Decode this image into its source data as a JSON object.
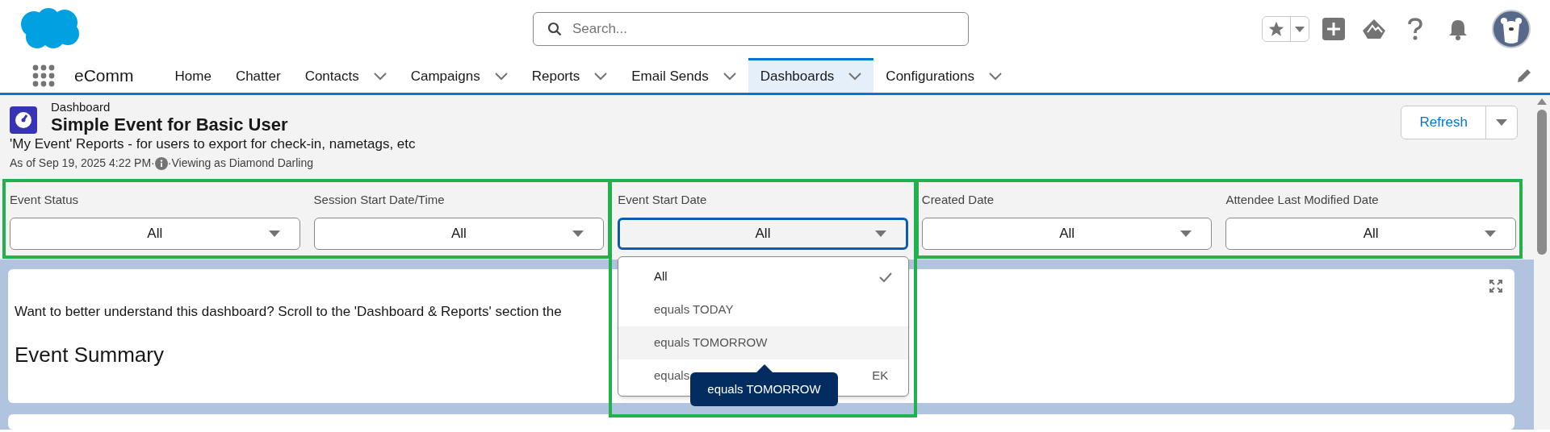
{
  "header": {
    "search": {
      "placeholder": "Search..."
    }
  },
  "nav": {
    "app_name": "eComm",
    "tabs": [
      {
        "label": "Home",
        "has_menu": false,
        "selected": false
      },
      {
        "label": "Chatter",
        "has_menu": false,
        "selected": false
      },
      {
        "label": "Contacts",
        "has_menu": true,
        "selected": false
      },
      {
        "label": "Campaigns",
        "has_menu": true,
        "selected": false
      },
      {
        "label": "Reports",
        "has_menu": true,
        "selected": false
      },
      {
        "label": "Email Sends",
        "has_menu": true,
        "selected": false
      },
      {
        "label": "Dashboards",
        "has_menu": true,
        "selected": true
      },
      {
        "label": "Configurations",
        "has_menu": true,
        "selected": false
      }
    ]
  },
  "dashboard": {
    "type_label": "Dashboard",
    "title": "Simple Event for Basic User",
    "description": "'My Event' Reports - for users to export for check-in, nametags, etc",
    "as_of": "As of Sep 19, 2025 4:22 PM·",
    "viewing_as": "·Viewing as Diamond Darling",
    "refresh_button": "Refresh"
  },
  "filters": [
    {
      "label": "Event Status",
      "value": "All",
      "focused": false
    },
    {
      "label": "Session Start Date/Time",
      "value": "All",
      "focused": false
    },
    {
      "label": "Event Start Date",
      "value": "All",
      "focused": true
    },
    {
      "label": "Created Date",
      "value": "All",
      "focused": false
    },
    {
      "label": "Attendee Last Modified Date",
      "value": "All",
      "focused": false
    }
  ],
  "filter_dropdown": {
    "items": [
      {
        "label": "All",
        "selected": true,
        "highlighted": false
      },
      {
        "label": "equals TODAY",
        "selected": false,
        "highlighted": false
      },
      {
        "label": "equals TOMORROW",
        "selected": false,
        "highlighted": true
      },
      {
        "label": "equals",
        "label_end": "EK",
        "selected": false,
        "highlighted": false
      }
    ],
    "tooltip": "equals TOMORROW"
  },
  "card": {
    "intro": "Want to better understand this dashboard? Scroll to the 'Dashboard & Reports' section the",
    "heading": "Event Summary"
  }
}
